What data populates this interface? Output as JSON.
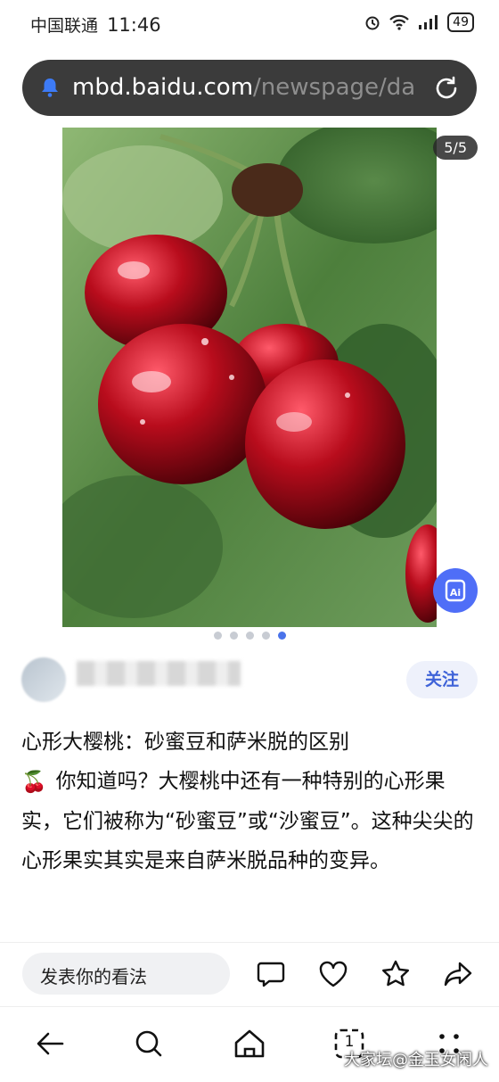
{
  "status": {
    "carrier": "中国联通",
    "time": "11:46",
    "battery": "49"
  },
  "url": {
    "host": "mbd.baidu.com",
    "path": "/newspage/da"
  },
  "gallery": {
    "counter": "5/5",
    "dots_total": 5,
    "active_dot": 5
  },
  "author": {
    "follow_label": "关注"
  },
  "article": {
    "title": "心形大樱桃：砂蜜豆和萨米脱的区别",
    "emoji": "🍒",
    "body": "你知道吗？大樱桃中还有一种特别的心形果实，它们被称为“砂蜜豆”或“沙蜜豆”。这种尖尖的心形果实其实是来自萨米脱品种的变异。"
  },
  "comment_bar": {
    "placeholder": "发表你的看法"
  },
  "icons": {
    "url_bar": [
      "bell-icon",
      "reload-icon"
    ],
    "actions": [
      "comment-icon",
      "like-icon",
      "favorite-icon",
      "share-icon"
    ],
    "nav": [
      "back-icon",
      "search-icon",
      "home-icon",
      "tabs-icon",
      "more-icon"
    ],
    "tabs_count": "1"
  },
  "colors": {
    "accent": "#4a73ea",
    "follow_bg": "#eef1fb",
    "url_bar_bg": "#3b3b3b"
  },
  "watermark": "大家坛@金玉女闲人"
}
